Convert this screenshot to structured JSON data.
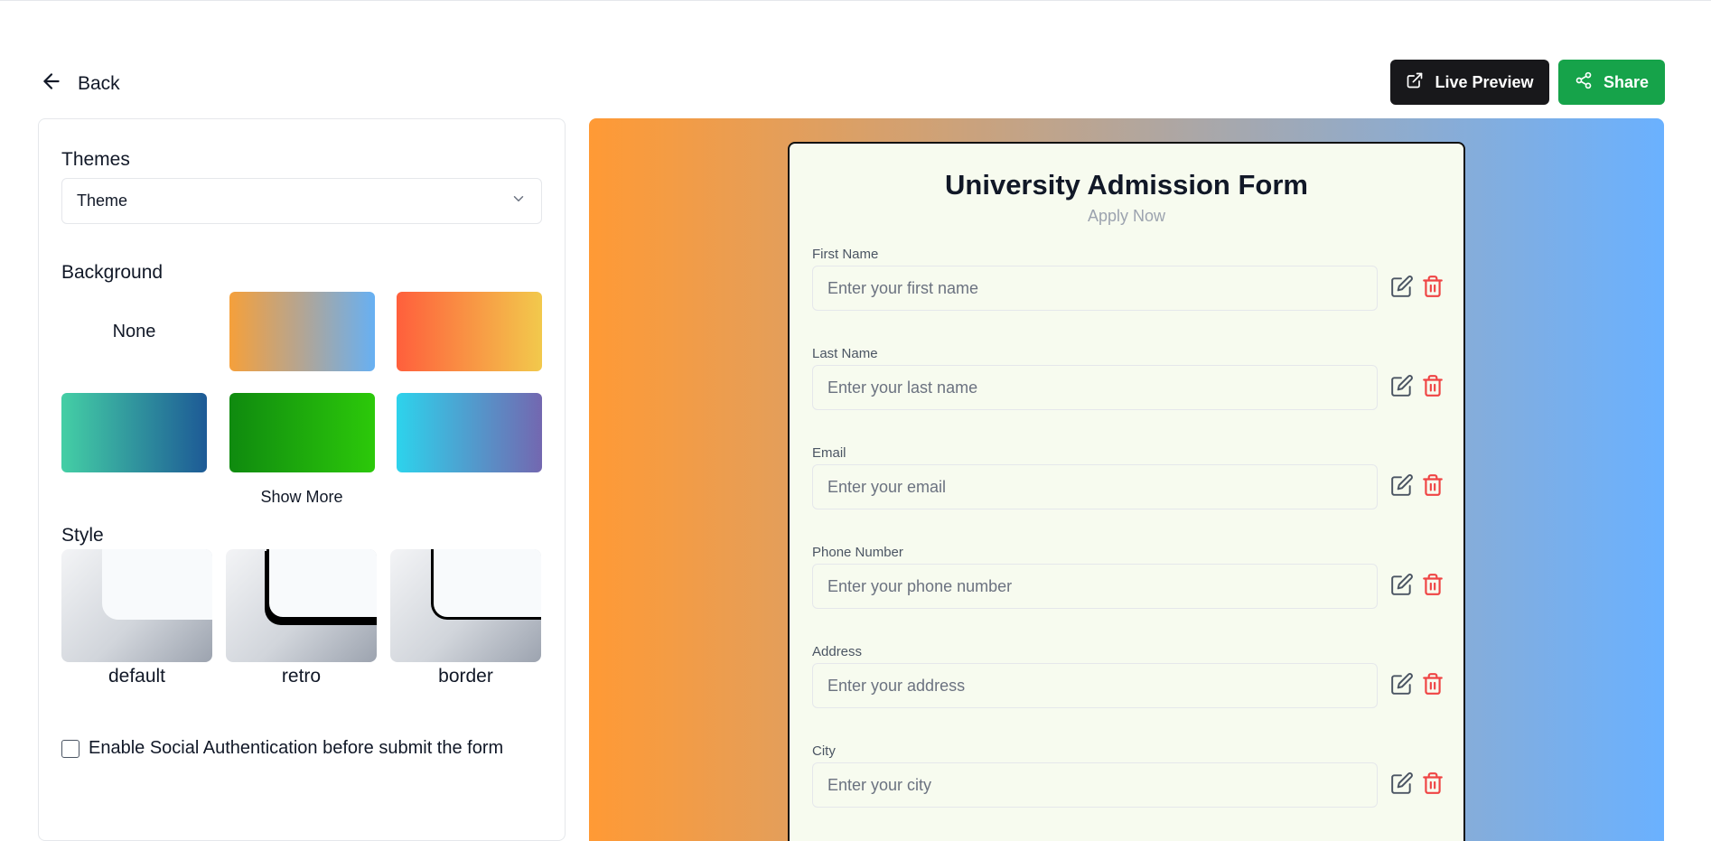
{
  "nav": {
    "back_label": "Back"
  },
  "toolbar": {
    "live_preview_label": "Live Preview",
    "share_label": "Share"
  },
  "sidebar": {
    "themes_label": "Themes",
    "theme_select_value": "Theme",
    "background_label": "Background",
    "background_none_label": "None",
    "show_more_label": "Show More",
    "style_label": "Style",
    "styles": [
      "default",
      "retro",
      "border"
    ],
    "social_auth_label": "Enable Social Authentication before submit the form"
  },
  "colors": {
    "preview_gradient": [
      "#ff9a35",
      "#6ab1ff"
    ],
    "swatches": [
      [
        "#f5a03b",
        "#b3a594",
        "#67b0f3"
      ],
      [
        "#ff5f3c",
        "#f2c94c"
      ],
      [
        "#44cfa5",
        "#1d5a96"
      ],
      [
        "#0f8a0f",
        "#2cc90a"
      ],
      [
        "#2dd3ec",
        "#7367b0"
      ]
    ],
    "share_button": "#16a34a",
    "preview_button": "#18181b",
    "delete_icon": "#ef4444"
  },
  "form": {
    "title": "University Admission Form",
    "subtitle": "Apply Now",
    "fields": [
      {
        "label": "First Name",
        "placeholder": "Enter your first name"
      },
      {
        "label": "Last Name",
        "placeholder": "Enter your last name"
      },
      {
        "label": "Email",
        "placeholder": "Enter your email"
      },
      {
        "label": "Phone Number",
        "placeholder": "Enter your phone number"
      },
      {
        "label": "Address",
        "placeholder": "Enter your address"
      },
      {
        "label": "City",
        "placeholder": "Enter your city"
      }
    ]
  }
}
